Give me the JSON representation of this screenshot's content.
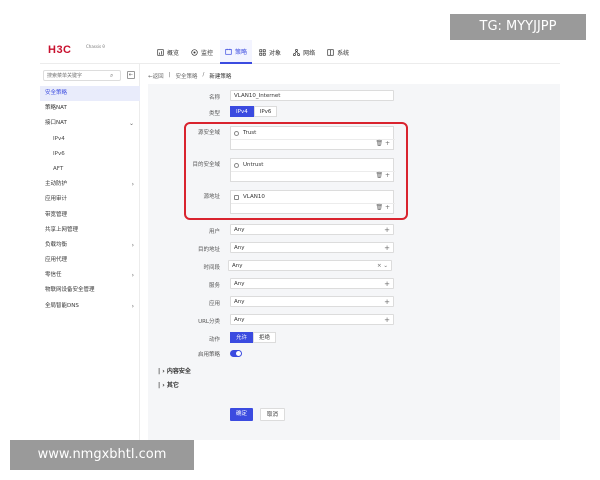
{
  "brand": {
    "logo": "H3C",
    "sub": "Chassis θ"
  },
  "nav": [
    {
      "label": "概览",
      "icon": "dashboard-icon"
    },
    {
      "label": "监控",
      "icon": "monitor-icon"
    },
    {
      "label": "策略",
      "icon": "policy-icon",
      "active": true
    },
    {
      "label": "对象",
      "icon": "object-icon"
    },
    {
      "label": "网络",
      "icon": "network-icon"
    },
    {
      "label": "系统",
      "icon": "system-icon"
    }
  ],
  "sidebar": {
    "search_placeholder": "搜索菜单关键字",
    "items": [
      {
        "label": "安全策略",
        "active": true
      },
      {
        "label": "策略NAT"
      },
      {
        "label": "接口NAT",
        "chevron": "⌄"
      },
      {
        "label": "IPv4",
        "sub": true
      },
      {
        "label": "IPv6",
        "sub": true
      },
      {
        "label": "AFT",
        "sub": true
      },
      {
        "label": "主动防护",
        "chevron": "›"
      },
      {
        "label": "应用审计"
      },
      {
        "label": "带宽管理"
      },
      {
        "label": "共享上网管理"
      },
      {
        "label": "负载均衡",
        "chevron": "›"
      },
      {
        "label": "应用代理"
      },
      {
        "label": "零信任",
        "chevron": "›"
      },
      {
        "label": "物联网设备安全管理"
      },
      {
        "label": "全局智能DNS",
        "chevron": "›"
      }
    ]
  },
  "breadcrumb": {
    "back": "←返回",
    "sep": "|",
    "level1": "安全策略",
    "sep2": "/",
    "current": "新建策略"
  },
  "form": {
    "name_label": "名称",
    "name_value": "VLAN10_Internet",
    "type_label": "类型",
    "type_ipv4": "IPv4",
    "type_ipv6": "IPv6",
    "src_zone_label": "源安全域",
    "src_zone_value": "Trust",
    "dst_zone_label": "目的安全域",
    "dst_zone_value": "Untrust",
    "src_addr_label": "源地址",
    "src_addr_value": "VLAN10",
    "user_label": "用户",
    "user_value": "Any",
    "dst_addr_label": "目的地址",
    "dst_addr_value": "Any",
    "time_label": "时间段",
    "time_value": "Any",
    "service_label": "服务",
    "service_value": "Any",
    "app_label": "应用",
    "app_value": "Any",
    "url_label": "URL分类",
    "url_value": "Any",
    "action_label": "动作",
    "action_allow": "允许",
    "action_deny": "拒绝",
    "enable_label": "启用策略",
    "section_content": "内容安全",
    "section_other": "其它",
    "ok": "确定",
    "cancel": "取消",
    "plus": "+",
    "zone_actions": "🗑 +",
    "time_actions": "× ⌄",
    "section_prefix": "| ›"
  },
  "watermark_top": "TG: MYYJJPP",
  "watermark_bottom": "www.nmgxbhtl.com",
  "colors": {
    "accent": "#3b4be0",
    "highlight": "#d9232e",
    "brand": "#c8102e"
  }
}
